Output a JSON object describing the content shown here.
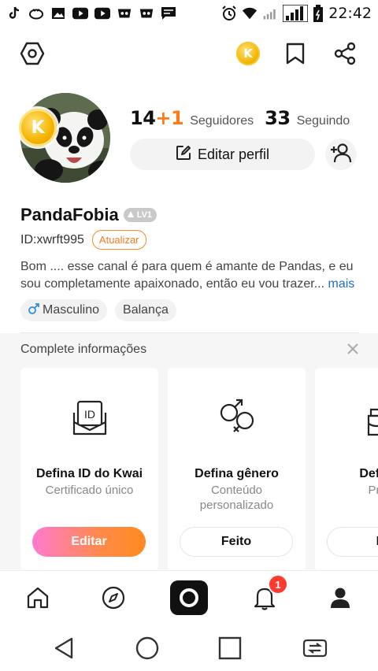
{
  "status_bar": {
    "time": "22:42",
    "icons": [
      "tiktok-icon",
      "app-icon",
      "image-icon",
      "youtube-icon",
      "youtube-icon",
      "game-icon",
      "game-icon",
      "message-icon",
      "alarm-icon",
      "wifi-icon",
      "signal-icon",
      "signal-3g-icon",
      "battery-icon"
    ]
  },
  "toolbar": {
    "icons": [
      "settings-hexagon-icon",
      "coin-icon",
      "bookmark-icon",
      "share-icon"
    ],
    "coin_letter": "K"
  },
  "profile": {
    "avatar_coin_letter": "K",
    "followers_count": "14",
    "followers_increment": "+1",
    "followers_label": "Seguidores",
    "following_count": "33",
    "following_label": "Seguindo",
    "edit_button_label": "Editar perfil",
    "name": "PandaFobia",
    "level": "LV1",
    "id": "ID:xwrft995",
    "update_label": "Atualizar",
    "bio": "Bom .... esse canal é para quem é amante de Pandas, e eu sou completamente apaixonado, então eu vou trazer...",
    "bio_more": "mais",
    "tags": [
      {
        "icon": "male-icon",
        "label": "Masculino"
      },
      {
        "label": "Balança"
      }
    ]
  },
  "complete_info": {
    "title": "Complete informações",
    "cards": [
      {
        "icon": "id-card-icon",
        "title": "Defina ID do Kwai",
        "subtitle": "Certificado único",
        "button": "Editar"
      },
      {
        "icon": "gender-icon",
        "title": "Defina gênero",
        "subtitle": "Conteúdo personalizado",
        "button": "Feito"
      },
      {
        "icon": "birthday-cake-icon",
        "title": "Defina a",
        "subtitle": "Própri",
        "button": "Fe"
      }
    ]
  },
  "bottom_nav": {
    "items": [
      "home-icon",
      "discover-icon",
      "camera-icon",
      "notifications-icon",
      "profile-icon"
    ],
    "notification_count": "1"
  },
  "colors": {
    "accent_orange": "#ff7a1a",
    "link_blue": "#1f6fc7",
    "badge_red": "#ff3a2e"
  }
}
